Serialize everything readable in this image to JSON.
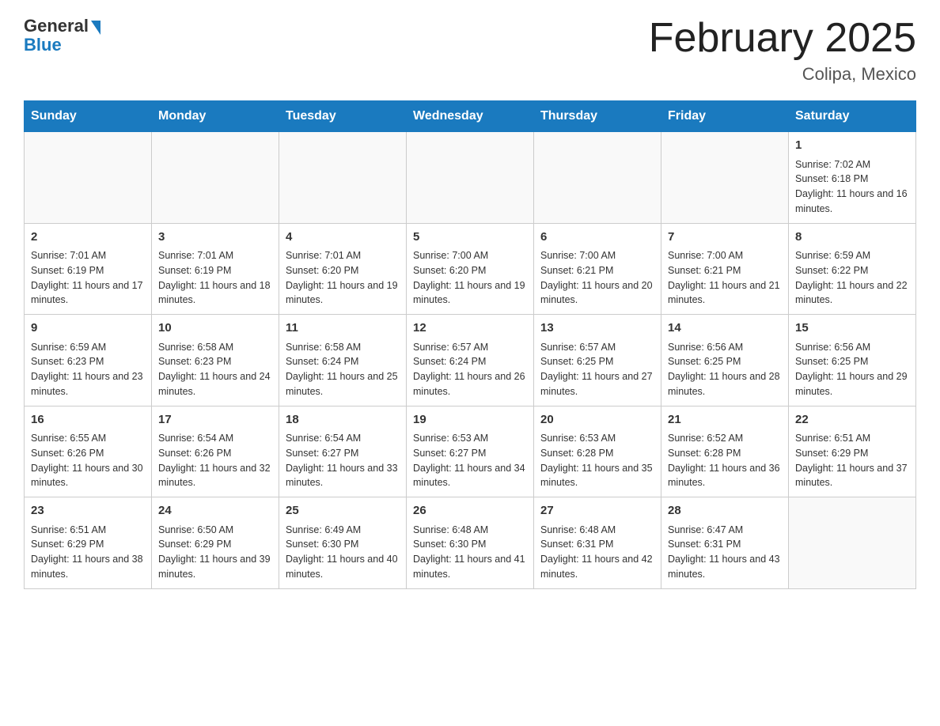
{
  "header": {
    "logo_general": "General",
    "logo_blue": "Blue",
    "month_title": "February 2025",
    "location": "Colipa, Mexico"
  },
  "weekdays": [
    "Sunday",
    "Monday",
    "Tuesday",
    "Wednesday",
    "Thursday",
    "Friday",
    "Saturday"
  ],
  "weeks": [
    [
      {
        "day": "",
        "info": ""
      },
      {
        "day": "",
        "info": ""
      },
      {
        "day": "",
        "info": ""
      },
      {
        "day": "",
        "info": ""
      },
      {
        "day": "",
        "info": ""
      },
      {
        "day": "",
        "info": ""
      },
      {
        "day": "1",
        "info": "Sunrise: 7:02 AM\nSunset: 6:18 PM\nDaylight: 11 hours and 16 minutes."
      }
    ],
    [
      {
        "day": "2",
        "info": "Sunrise: 7:01 AM\nSunset: 6:19 PM\nDaylight: 11 hours and 17 minutes."
      },
      {
        "day": "3",
        "info": "Sunrise: 7:01 AM\nSunset: 6:19 PM\nDaylight: 11 hours and 18 minutes."
      },
      {
        "day": "4",
        "info": "Sunrise: 7:01 AM\nSunset: 6:20 PM\nDaylight: 11 hours and 19 minutes."
      },
      {
        "day": "5",
        "info": "Sunrise: 7:00 AM\nSunset: 6:20 PM\nDaylight: 11 hours and 19 minutes."
      },
      {
        "day": "6",
        "info": "Sunrise: 7:00 AM\nSunset: 6:21 PM\nDaylight: 11 hours and 20 minutes."
      },
      {
        "day": "7",
        "info": "Sunrise: 7:00 AM\nSunset: 6:21 PM\nDaylight: 11 hours and 21 minutes."
      },
      {
        "day": "8",
        "info": "Sunrise: 6:59 AM\nSunset: 6:22 PM\nDaylight: 11 hours and 22 minutes."
      }
    ],
    [
      {
        "day": "9",
        "info": "Sunrise: 6:59 AM\nSunset: 6:23 PM\nDaylight: 11 hours and 23 minutes."
      },
      {
        "day": "10",
        "info": "Sunrise: 6:58 AM\nSunset: 6:23 PM\nDaylight: 11 hours and 24 minutes."
      },
      {
        "day": "11",
        "info": "Sunrise: 6:58 AM\nSunset: 6:24 PM\nDaylight: 11 hours and 25 minutes."
      },
      {
        "day": "12",
        "info": "Sunrise: 6:57 AM\nSunset: 6:24 PM\nDaylight: 11 hours and 26 minutes."
      },
      {
        "day": "13",
        "info": "Sunrise: 6:57 AM\nSunset: 6:25 PM\nDaylight: 11 hours and 27 minutes."
      },
      {
        "day": "14",
        "info": "Sunrise: 6:56 AM\nSunset: 6:25 PM\nDaylight: 11 hours and 28 minutes."
      },
      {
        "day": "15",
        "info": "Sunrise: 6:56 AM\nSunset: 6:25 PM\nDaylight: 11 hours and 29 minutes."
      }
    ],
    [
      {
        "day": "16",
        "info": "Sunrise: 6:55 AM\nSunset: 6:26 PM\nDaylight: 11 hours and 30 minutes."
      },
      {
        "day": "17",
        "info": "Sunrise: 6:54 AM\nSunset: 6:26 PM\nDaylight: 11 hours and 32 minutes."
      },
      {
        "day": "18",
        "info": "Sunrise: 6:54 AM\nSunset: 6:27 PM\nDaylight: 11 hours and 33 minutes."
      },
      {
        "day": "19",
        "info": "Sunrise: 6:53 AM\nSunset: 6:27 PM\nDaylight: 11 hours and 34 minutes."
      },
      {
        "day": "20",
        "info": "Sunrise: 6:53 AM\nSunset: 6:28 PM\nDaylight: 11 hours and 35 minutes."
      },
      {
        "day": "21",
        "info": "Sunrise: 6:52 AM\nSunset: 6:28 PM\nDaylight: 11 hours and 36 minutes."
      },
      {
        "day": "22",
        "info": "Sunrise: 6:51 AM\nSunset: 6:29 PM\nDaylight: 11 hours and 37 minutes."
      }
    ],
    [
      {
        "day": "23",
        "info": "Sunrise: 6:51 AM\nSunset: 6:29 PM\nDaylight: 11 hours and 38 minutes."
      },
      {
        "day": "24",
        "info": "Sunrise: 6:50 AM\nSunset: 6:29 PM\nDaylight: 11 hours and 39 minutes."
      },
      {
        "day": "25",
        "info": "Sunrise: 6:49 AM\nSunset: 6:30 PM\nDaylight: 11 hours and 40 minutes."
      },
      {
        "day": "26",
        "info": "Sunrise: 6:48 AM\nSunset: 6:30 PM\nDaylight: 11 hours and 41 minutes."
      },
      {
        "day": "27",
        "info": "Sunrise: 6:48 AM\nSunset: 6:31 PM\nDaylight: 11 hours and 42 minutes."
      },
      {
        "day": "28",
        "info": "Sunrise: 6:47 AM\nSunset: 6:31 PM\nDaylight: 11 hours and 43 minutes."
      },
      {
        "day": "",
        "info": ""
      }
    ]
  ]
}
